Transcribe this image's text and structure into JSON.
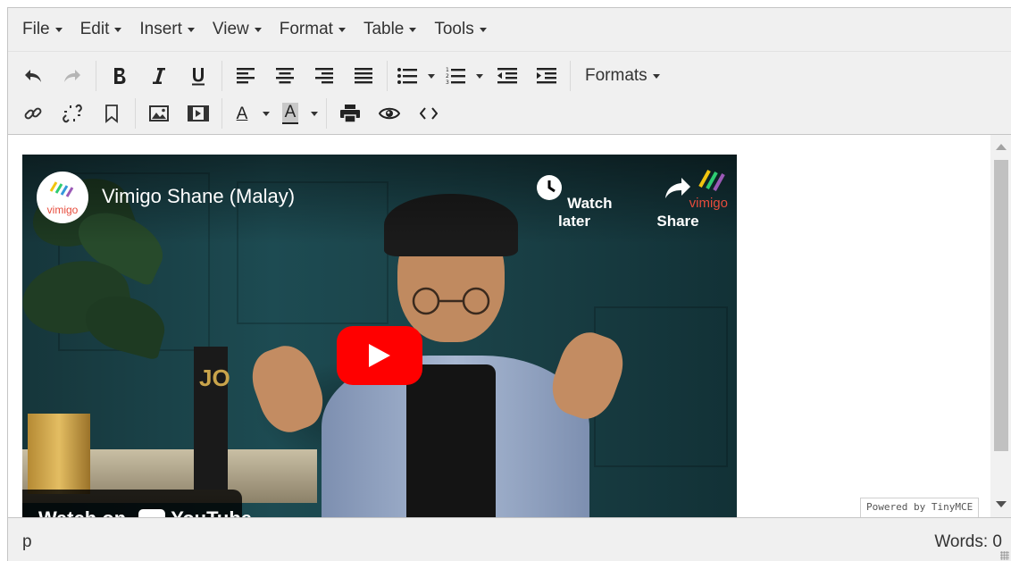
{
  "menubar": {
    "items": [
      {
        "label": "File"
      },
      {
        "label": "Edit"
      },
      {
        "label": "Insert"
      },
      {
        "label": "View"
      },
      {
        "label": "Format"
      },
      {
        "label": "Table"
      },
      {
        "label": "Tools"
      }
    ]
  },
  "toolbar": {
    "row1": [
      "undo-icon",
      "redo-icon",
      "bold-icon",
      "italic-icon",
      "underline-icon",
      "align-left-icon",
      "align-center-icon",
      "align-right-icon",
      "align-justify-icon",
      "bullet-list-icon",
      "numbered-list-icon",
      "outdent-icon",
      "indent-icon"
    ],
    "formats_label": "Formats",
    "row2": [
      "link-icon",
      "unlink-icon",
      "bookmark-icon",
      "image-icon",
      "media-icon",
      "text-color-icon",
      "background-color-icon",
      "print-icon",
      "preview-icon",
      "source-code-icon"
    ],
    "text_color_letter": "A",
    "bg_color_letter": "A",
    "bg_color_swatch": "#c8c8c8"
  },
  "video": {
    "channel_logo_text": "vimigo",
    "title": "Vimigo Shane (Malay)",
    "watch_later_label": "Watch later",
    "share_label": "Share",
    "watermark_text": "vimigo",
    "watch_on_label": "Watch on",
    "youtube_label": "YouTube",
    "play_color": "#ff0000"
  },
  "powered_by": "Powered by TinyMCE",
  "statusbar": {
    "path": "p",
    "word_count": "Words: 0"
  }
}
